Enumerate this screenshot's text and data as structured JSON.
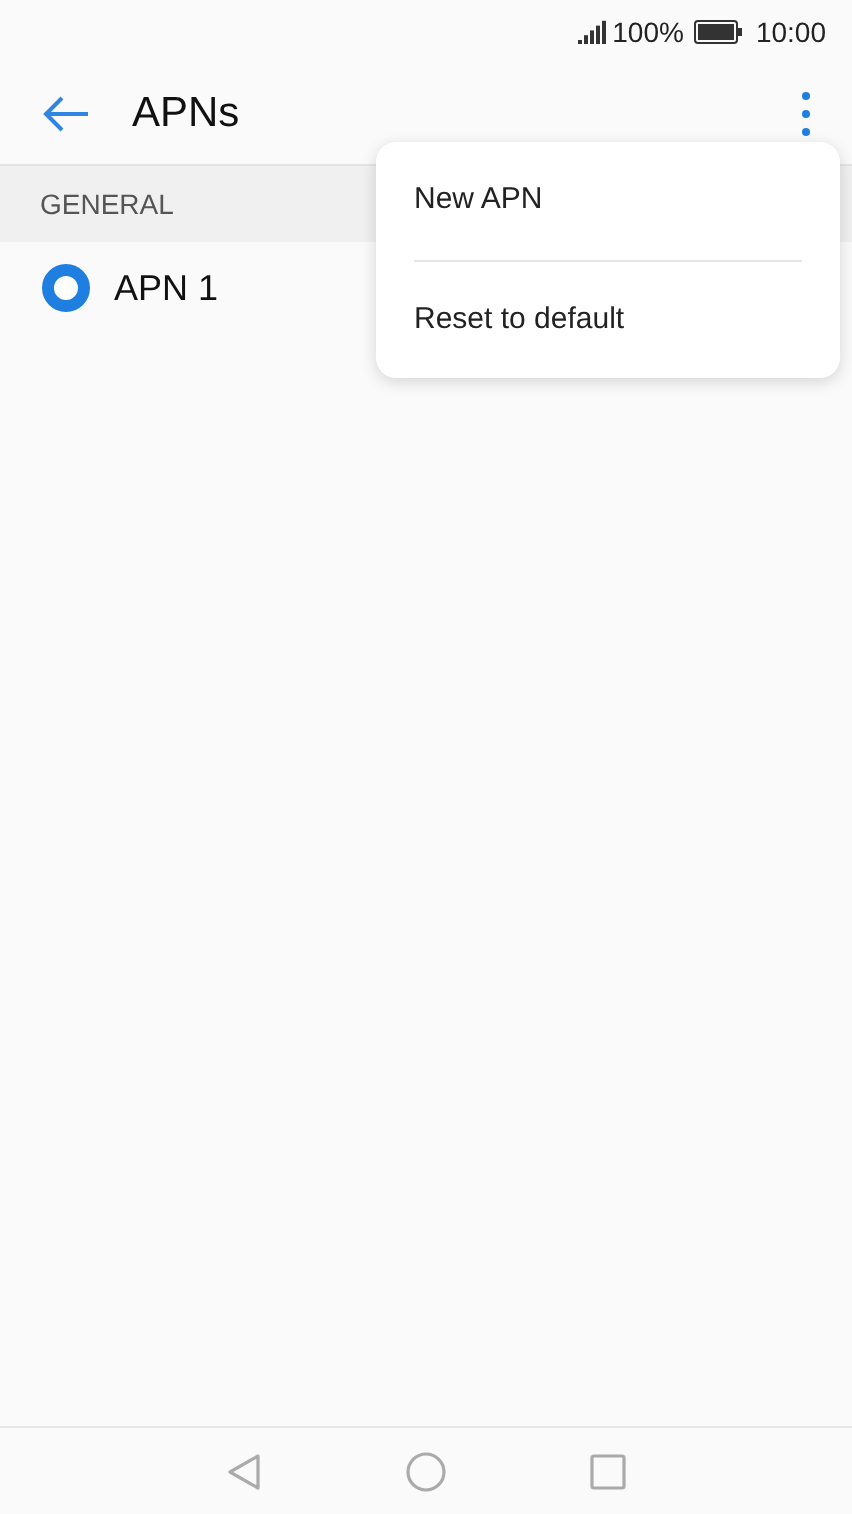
{
  "status_bar": {
    "battery": "100%",
    "time": "10:00"
  },
  "app_bar": {
    "title": "APNs"
  },
  "section": {
    "title": "GENERAL"
  },
  "apns": [
    {
      "name": "APN 1",
      "selected": true
    }
  ],
  "menu": {
    "items": [
      "New APN",
      "Reset to default"
    ]
  }
}
